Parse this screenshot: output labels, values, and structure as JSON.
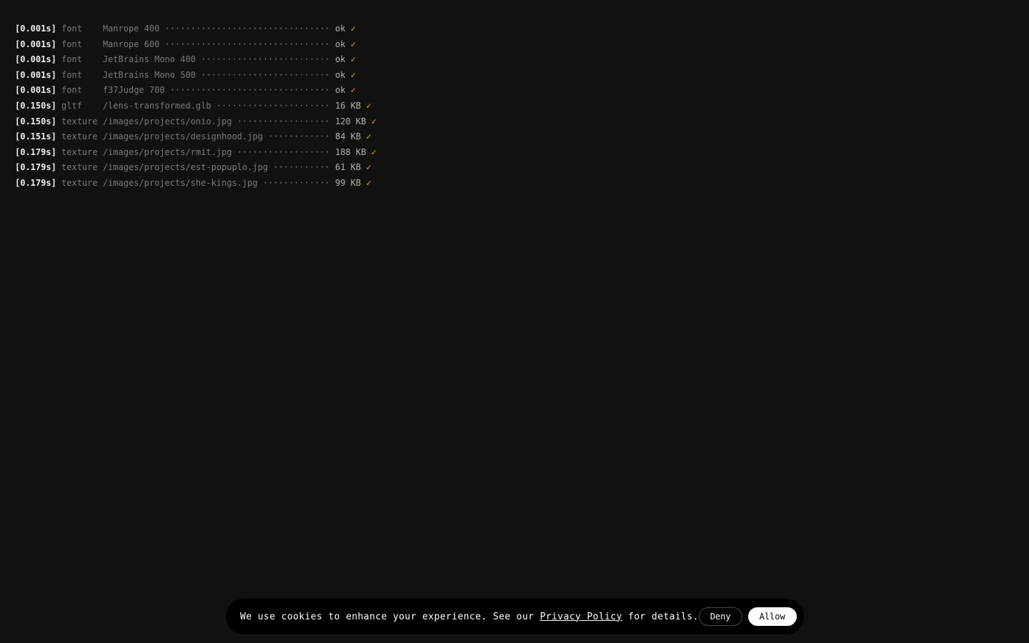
{
  "log": [
    {
      "ts": "[0.001s]",
      "kind": "font   ",
      "resource": "Manrope 400",
      "dots": "································",
      "value": "ok",
      "check": "✓"
    },
    {
      "ts": "[0.001s]",
      "kind": "font   ",
      "resource": "Manrope 600",
      "dots": "································",
      "value": "ok",
      "check": "✓"
    },
    {
      "ts": "[0.001s]",
      "kind": "font   ",
      "resource": "JetBrains Mono 400",
      "dots": "·························",
      "value": "ok",
      "check": "✓"
    },
    {
      "ts": "[0.001s]",
      "kind": "font   ",
      "resource": "JetBrains Mono 500",
      "dots": "·························",
      "value": "ok",
      "check": "✓"
    },
    {
      "ts": "[0.001s]",
      "kind": "font   ",
      "resource": "f37Judge 700",
      "dots": "·······························",
      "value": "ok",
      "check": "✓"
    },
    {
      "ts": "[0.150s]",
      "kind": "gltf   ",
      "resource": "/lens-transformed.glb",
      "dots": "······················",
      "value": "16 KB",
      "check": "✓"
    },
    {
      "ts": "[0.150s]",
      "kind": "texture",
      "resource": "/images/projects/onio.jpg",
      "dots": "··················",
      "value": "120 KB",
      "check": "✓"
    },
    {
      "ts": "[0.151s]",
      "kind": "texture",
      "resource": "/images/projects/designhood.jpg",
      "dots": "············",
      "value": "84 KB",
      "check": "✓"
    },
    {
      "ts": "[0.179s]",
      "kind": "texture",
      "resource": "/images/projects/rmit.jpg",
      "dots": "··················",
      "value": "188 KB",
      "check": "✓"
    },
    {
      "ts": "[0.179s]",
      "kind": "texture",
      "resource": "/images/projects/est-popuplo.jpg",
      "dots": "···········",
      "value": "61 KB",
      "check": "✓"
    },
    {
      "ts": "[0.179s]",
      "kind": "texture",
      "resource": "/images/projects/she-kings.jpg",
      "dots": "·············",
      "value": "99 KB",
      "check": "✓"
    }
  ],
  "cookie": {
    "text_before": "We use cookies to enhance your experience. See our ",
    "link_label": "Privacy Policy",
    "text_after": " for details.",
    "deny_label": "Deny",
    "allow_label": "Allow"
  },
  "colors": {
    "background": "#121110",
    "timestamp": "#f1eee7",
    "muted": "#7d7a74",
    "check": "#e2ad18",
    "cookie_bar": "#000000"
  }
}
